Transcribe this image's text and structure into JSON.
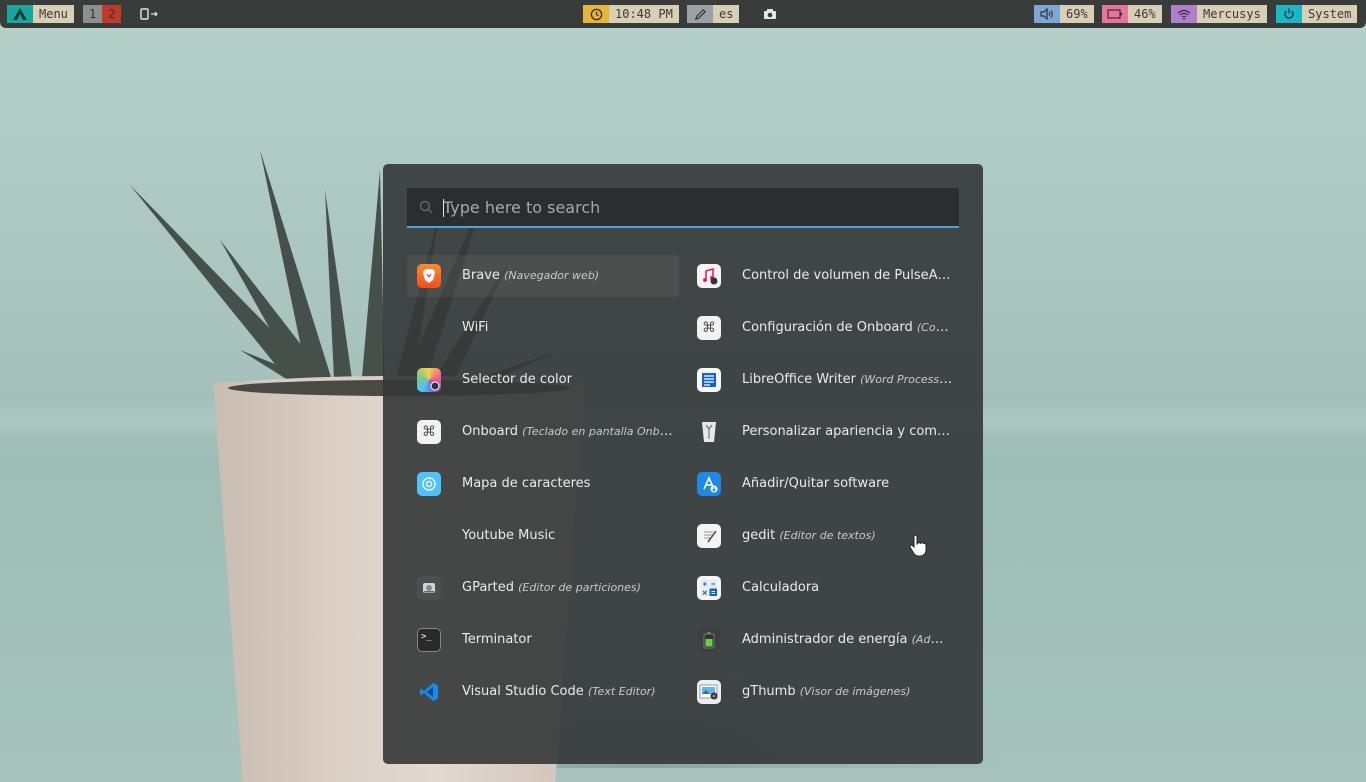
{
  "panel": {
    "menu_label": "Menu",
    "workspaces": [
      "1",
      "2"
    ],
    "clock": "10:48 PM",
    "keyboard_layout": "es",
    "volume": "69%",
    "battery": "46%",
    "wifi": "Mercusys",
    "system": "System"
  },
  "launcher": {
    "search_placeholder": "Type here to search",
    "left": [
      {
        "name": "Brave",
        "desc": "(Navegador web)",
        "icon": "brave-icon"
      },
      {
        "name": "WiFi",
        "desc": "",
        "icon": ""
      },
      {
        "name": "Selector de color",
        "desc": "",
        "icon": "color-picker-icon"
      },
      {
        "name": "Onboard",
        "desc": "(Teclado en pantalla Onboard)",
        "icon": "onboard-icon"
      },
      {
        "name": "Mapa de caracteres",
        "desc": "",
        "icon": "charmap-icon"
      },
      {
        "name": "Youtube Music",
        "desc": "",
        "icon": ""
      },
      {
        "name": "GParted",
        "desc": "(Editor de particiones)",
        "icon": "gparted-icon"
      },
      {
        "name": "Terminator",
        "desc": "",
        "icon": "terminal-icon"
      },
      {
        "name": "Visual Studio Code",
        "desc": "(Text Editor)",
        "icon": "vscode-icon"
      }
    ],
    "right": [
      {
        "name": "Control de volumen de PulseAu…",
        "desc": "",
        "icon": "pulseaudio-icon"
      },
      {
        "name": "Configuración de Onboard",
        "desc": "(Config…",
        "icon": "onboard-settings-icon"
      },
      {
        "name": "LibreOffice Writer",
        "desc": "(Word Processor)",
        "icon": "writer-icon"
      },
      {
        "name": "Personalizar apariencia y compo…",
        "desc": "",
        "icon": "appearance-icon"
      },
      {
        "name": "Añadir/Quitar software",
        "desc": "",
        "icon": "software-icon"
      },
      {
        "name": "gedit",
        "desc": "(Editor de textos)",
        "icon": "gedit-icon"
      },
      {
        "name": "Calculadora",
        "desc": "",
        "icon": "calculator-icon"
      },
      {
        "name": "Administrador de energía",
        "desc": "(Admini…",
        "icon": "power-manager-icon"
      },
      {
        "name": "gThumb",
        "desc": "(Visor de imágenes)",
        "icon": "gthumb-icon"
      }
    ]
  },
  "colors": {
    "accent": "#4aa3e0",
    "panel_bg": "#383c3b",
    "panel_label": "#d9cfb5"
  }
}
